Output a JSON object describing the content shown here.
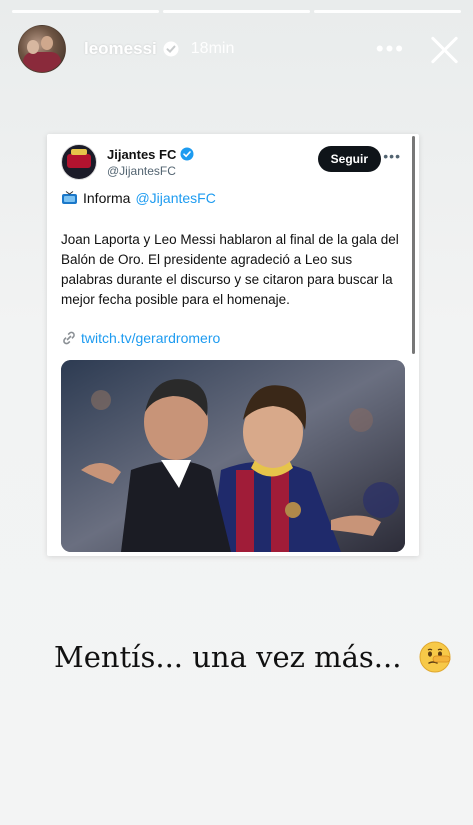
{
  "story": {
    "username": "leomessi",
    "time": "18min",
    "more_icon": "more-horizontal-icon",
    "close_icon": "close-icon"
  },
  "tweet": {
    "name": "Jijantes FC",
    "handle": "@JijantesFC",
    "follow_label": "Seguir",
    "informa_label": "Informa",
    "informa_mention": "@JijantesFC",
    "text": "Joan Laporta y Leo Messi hablaron al final de la gala del Balón de Oro. El presidente agradeció a Leo sus palabras  durante el discurso y se citaron para buscar la mejor fecha posible para el homenaje.",
    "link": "twitch.tv/gerardromero"
  },
  "caption": {
    "text": "Mentís... una vez más..."
  },
  "colors": {
    "link": "#1d9bf0",
    "follow_bg": "#0f1419"
  }
}
